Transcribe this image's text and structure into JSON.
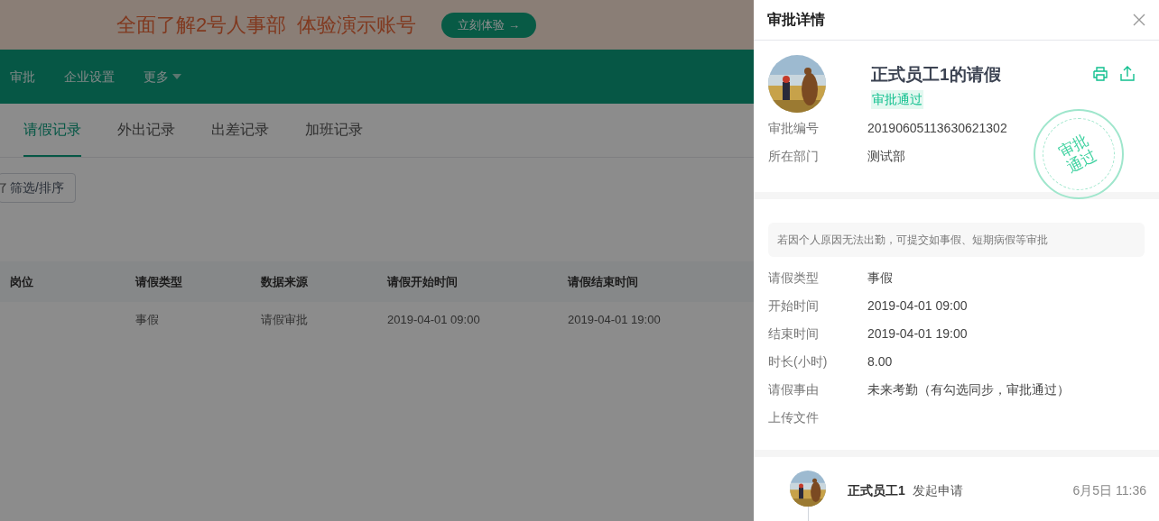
{
  "banner": {
    "text": "全面了解2号人事部  体验演示账号",
    "button": "立刻体验 →"
  },
  "nav": {
    "items": [
      {
        "label": "审批",
        "dropdown": false
      },
      {
        "label": "企业设置",
        "dropdown": false
      },
      {
        "label": "更多",
        "dropdown": true
      }
    ]
  },
  "tabs": [
    {
      "label": "请假记录",
      "selected": true
    },
    {
      "label": "外出记录",
      "selected": false
    },
    {
      "label": "出差记录",
      "selected": false
    },
    {
      "label": "加班记录",
      "selected": false
    }
  ],
  "filter_button": "筛选/排序",
  "table": {
    "columns": [
      "岗位",
      "请假类型",
      "数据来源",
      "请假开始时间",
      "请假结束时间"
    ],
    "rows": [
      [
        "",
        "事假",
        "请假审批",
        "2019-04-01 09:00",
        "2019-04-01 19:00"
      ]
    ]
  },
  "drawer": {
    "title": "审批详情",
    "heading": "正式员工1的请假",
    "status": "审批通过",
    "stamp": "审批通过",
    "info": [
      {
        "label": "审批编号",
        "value": "20190605113630621302"
      },
      {
        "label": "所在部门",
        "value": "测试部"
      }
    ],
    "notice": "若因个人原因无法出勤，可提交如事假、短期病假等审批",
    "fields": [
      {
        "label": "请假类型",
        "value": "事假"
      },
      {
        "label": "开始时间",
        "value": "2019-04-01 09:00"
      },
      {
        "label": "结束时间",
        "value": "2019-04-01 19:00"
      },
      {
        "label": "时长(小时)",
        "value": "8.00"
      },
      {
        "label": "请假事由",
        "value": "未来考勤（有勾选同步，审批通过）"
      },
      {
        "label": "上传文件"
      }
    ],
    "timeline": [
      {
        "name": "正式员工1",
        "action": "发起申请",
        "time": "6月5日 11:36"
      }
    ]
  }
}
